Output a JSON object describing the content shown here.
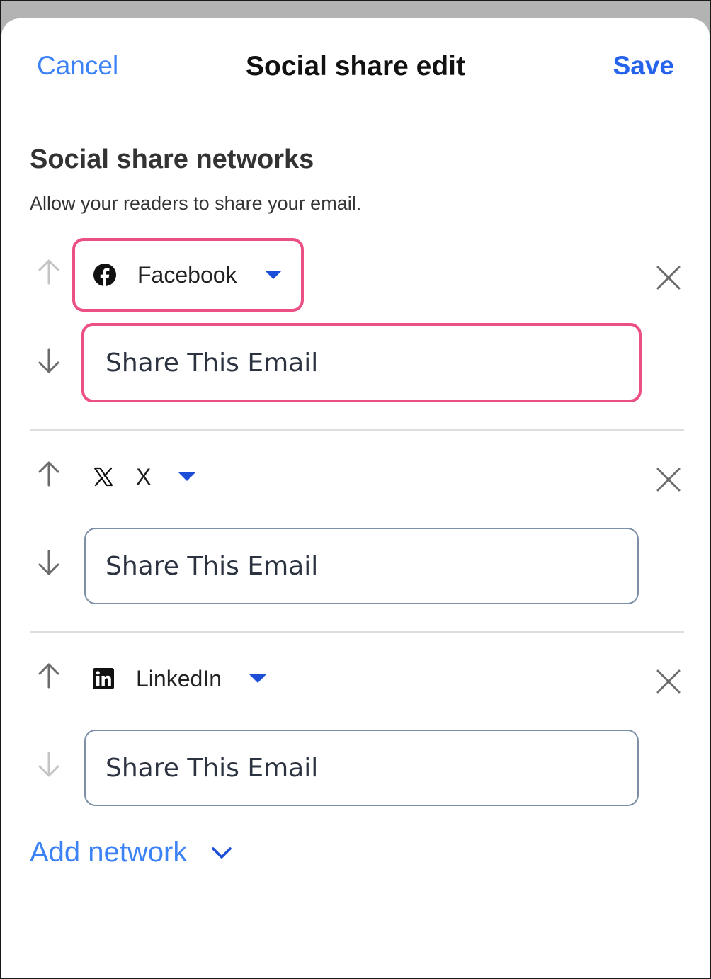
{
  "header": {
    "cancel_label": "Cancel",
    "title": "Social share edit",
    "save_label": "Save"
  },
  "section": {
    "title": "Social share networks",
    "subtitle": "Allow your readers to share your email."
  },
  "networks": [
    {
      "name": "Facebook",
      "icon": "facebook-icon",
      "share_text": "Share This Email",
      "highlighted": true,
      "up_enabled": false,
      "down_enabled": true
    },
    {
      "name": "X",
      "icon": "x-icon",
      "share_text": "Share This Email",
      "highlighted": false,
      "up_enabled": true,
      "down_enabled": true
    },
    {
      "name": "LinkedIn",
      "icon": "linkedin-icon",
      "share_text": "Share This Email",
      "highlighted": false,
      "up_enabled": true,
      "down_enabled": false
    }
  ],
  "add_network_label": "Add network",
  "colors": {
    "link_blue": "#3b82f6",
    "save_blue": "#2563eb",
    "caret_blue": "#1d4ed8",
    "highlight_pink": "#ec4f86",
    "input_border": "#7c8fa6",
    "arrow_enabled": "#6b6b6b",
    "arrow_disabled": "#c4c4c4"
  }
}
